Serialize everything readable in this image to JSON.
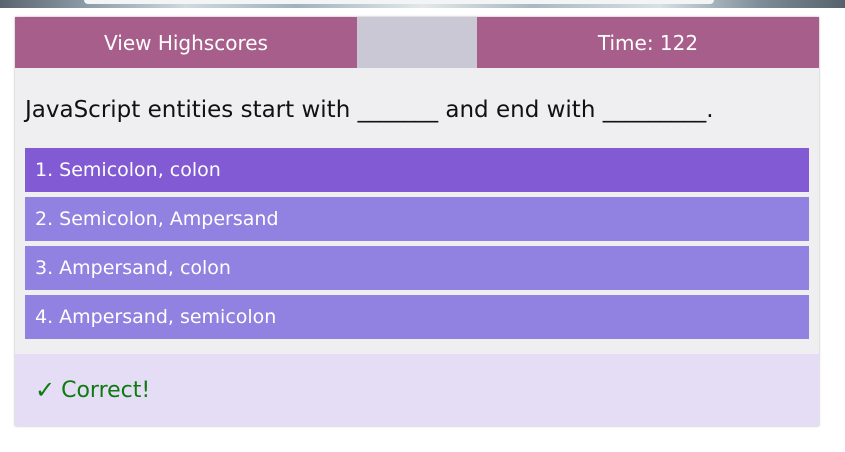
{
  "header": {
    "highscores_label": "View Highscores",
    "timer_label": "Time: 122"
  },
  "question": {
    "text": "JavaScript entities start with _______ and end with _________."
  },
  "answers": [
    {
      "label": "1. Semicolon, colon",
      "selected": true
    },
    {
      "label": "2. Semicolon, Ampersand",
      "selected": false
    },
    {
      "label": "3. Ampersand, colon",
      "selected": false
    },
    {
      "label": "4. Ampersand, semicolon",
      "selected": false
    }
  ],
  "feedback": {
    "icon": "check-icon",
    "icon_glyph": "✓",
    "text": "Correct!"
  },
  "colors": {
    "header_bg": "#a75e8a",
    "answer_bg": "#9181e0",
    "answer_selected_bg": "#825ad4",
    "feedback_bg": "#e5dcf6",
    "feedback_text": "#0d7a0d"
  }
}
